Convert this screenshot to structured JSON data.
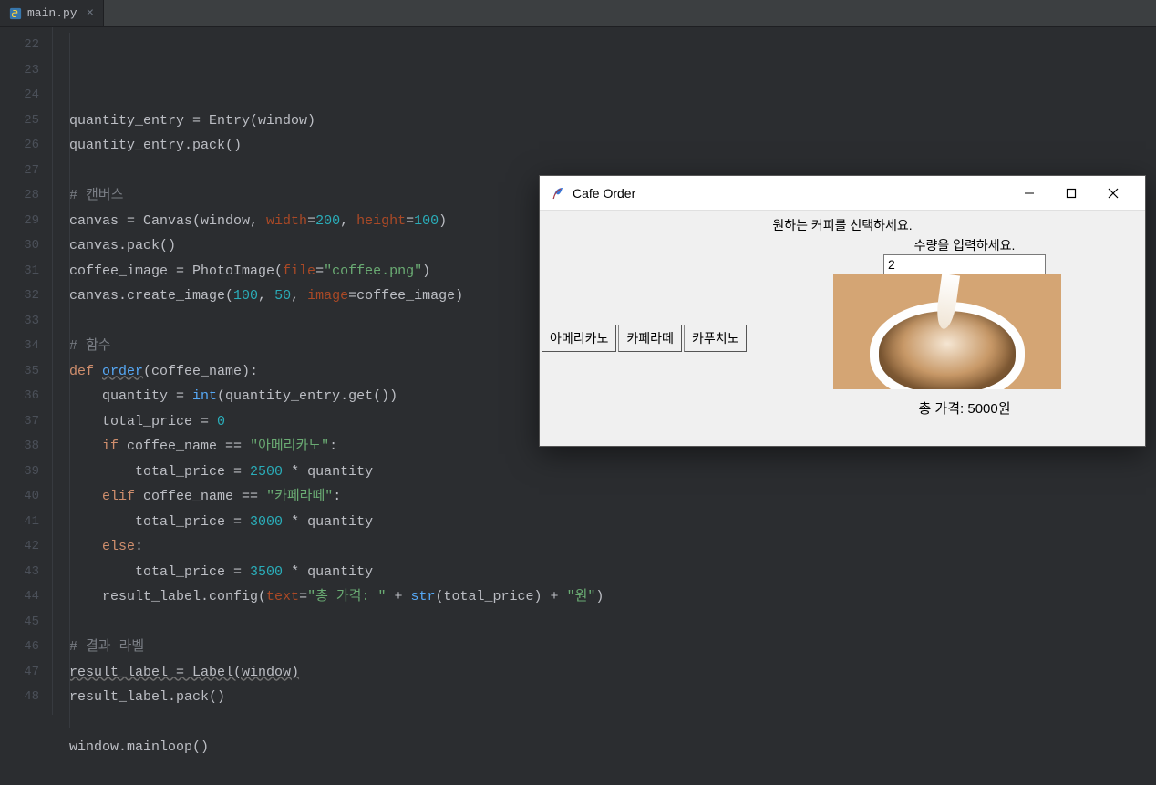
{
  "tab": {
    "filename": "main.py",
    "close_glyph": "×"
  },
  "gutter": {
    "start": 22,
    "end": 48
  },
  "code_lines": [
    {
      "indent": 0,
      "html": "quantity_entry = Entry(window)"
    },
    {
      "indent": 0,
      "html": "quantity_entry.pack()"
    },
    {
      "indent": 0,
      "html": ""
    },
    {
      "indent": 0,
      "html": "<span class='c-comment'># 캔버스</span>"
    },
    {
      "indent": 0,
      "html": "canvas = Canvas(window, <span class='c-named'>width</span>=<span class='c-num'>200</span>, <span class='c-named'>height</span>=<span class='c-num'>100</span>)"
    },
    {
      "indent": 0,
      "html": "canvas.pack()"
    },
    {
      "indent": 0,
      "html": "coffee_image = PhotoImage(<span class='c-named'>file</span>=<span class='c-str'>\"coffee.png\"</span>)"
    },
    {
      "indent": 0,
      "html": "canvas.create_image(<span class='c-num'>100</span>, <span class='c-num'>50</span>, <span class='c-named'>image</span>=coffee_image)"
    },
    {
      "indent": 0,
      "html": ""
    },
    {
      "indent": 0,
      "html": "<span class='c-comment'># 함수</span>"
    },
    {
      "indent": 0,
      "html": "<span class='c-kw'>def </span><span class='c-def underline'>order</span>(coffee_name):"
    },
    {
      "indent": 1,
      "html": "quantity = <span class='c-def'>int</span>(quantity_entry.get())"
    },
    {
      "indent": 1,
      "html": "total_price = <span class='c-num'>0</span>"
    },
    {
      "indent": 1,
      "html": "<span class='c-kw'>if </span>coffee_name == <span class='c-str'>\"아메리카노\"</span>:"
    },
    {
      "indent": 2,
      "html": "total_price = <span class='c-num'>2500</span> * quantity"
    },
    {
      "indent": 1,
      "html": "<span class='c-kw'>elif </span>coffee_name == <span class='c-str'>\"카페라떼\"</span>:"
    },
    {
      "indent": 2,
      "html": "total_price = <span class='c-num'>3000</span> * quantity"
    },
    {
      "indent": 1,
      "html": "<span class='c-kw'>else</span>:"
    },
    {
      "indent": 2,
      "html": "total_price = <span class='c-num'>3500</span> * quantity"
    },
    {
      "indent": 1,
      "html": "result_label.config(<span class='c-named'>text</span>=<span class='c-str'>\"총 가격: \"</span> + <span class='c-def'>str</span>(total_price) + <span class='c-str'>\"원\"</span>)"
    },
    {
      "indent": 0,
      "html": ""
    },
    {
      "indent": 0,
      "html": "<span class='c-comment'># 결과 라벨</span>"
    },
    {
      "indent": 0,
      "html": "<span class='underline'>result_label = Label(window)</span>"
    },
    {
      "indent": 0,
      "html": "result_label.pack()"
    },
    {
      "indent": 0,
      "html": ""
    },
    {
      "indent": 0,
      "html": "window.mainloop()"
    },
    {
      "indent": 0,
      "html": ""
    }
  ],
  "app": {
    "title": "Cafe Order",
    "label_select": "원하는 커피를 선택하세요.",
    "label_qty": "수량을 입력하세요.",
    "entry_value": "2",
    "buttons": [
      "아메리카노",
      "카페라떼",
      "카푸치노"
    ],
    "result": "총 가격: 5000원"
  }
}
